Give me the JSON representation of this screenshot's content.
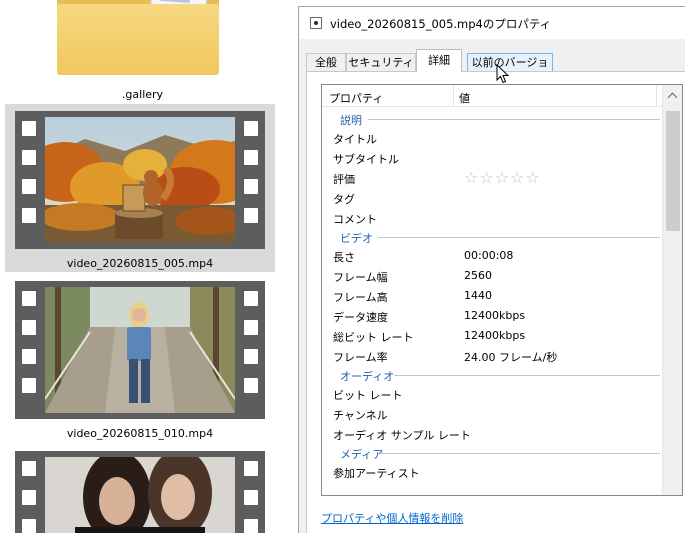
{
  "explorer": {
    "folder_label": ".gallery",
    "files": [
      {
        "name": "video_20260815_005.mp4",
        "selected": true,
        "thumbnail": "autumn-forest-squirrel"
      },
      {
        "name": "video_20260815_010.mp4",
        "selected": false,
        "thumbnail": "woman-on-bridge"
      },
      {
        "name": "",
        "selected": false,
        "thumbnail": "two-women-portrait"
      }
    ]
  },
  "dialog": {
    "title": "video_20260815_005.mp4のプロパティ",
    "tabs": [
      {
        "label": "全般",
        "active": false
      },
      {
        "label": "セキュリティ",
        "active": false
      },
      {
        "label": "詳細",
        "active": true
      },
      {
        "label": "以前のバージョン",
        "active": false,
        "hover": true
      }
    ],
    "columns": {
      "property": "プロパティ",
      "value": "値"
    },
    "sections": {
      "description": {
        "header": "説明",
        "rows": [
          {
            "label": "タイトル",
            "value": ""
          },
          {
            "label": "サブタイトル",
            "value": ""
          },
          {
            "label": "評価",
            "value": "☆☆☆☆☆"
          },
          {
            "label": "タグ",
            "value": ""
          },
          {
            "label": "コメント",
            "value": ""
          }
        ]
      },
      "video": {
        "header": "ビデオ",
        "rows": [
          {
            "label": "長さ",
            "value": "00:00:08"
          },
          {
            "label": "フレーム幅",
            "value": "2560"
          },
          {
            "label": "フレーム高",
            "value": "1440"
          },
          {
            "label": "データ速度",
            "value": "12400kbps"
          },
          {
            "label": "総ビット レート",
            "value": "12400kbps"
          },
          {
            "label": "フレーム率",
            "value": "24.00 フレーム/秒"
          }
        ]
      },
      "audio": {
        "header": "オーディオ",
        "rows": [
          {
            "label": "ビット レート",
            "value": ""
          },
          {
            "label": "チャンネル",
            "value": ""
          },
          {
            "label": "オーディオ サンプル レート",
            "value": ""
          }
        ]
      },
      "media": {
        "header": "メディア",
        "rows": [
          {
            "label": "参加アーティスト",
            "value": ""
          }
        ]
      }
    },
    "remove_link": "プロパティや個人情報を削除"
  },
  "colors": {
    "section_header": "#1f5fb3",
    "link": "#0066cc",
    "selection": "#d9d9d9",
    "film_strip": "#5d5d5d"
  }
}
